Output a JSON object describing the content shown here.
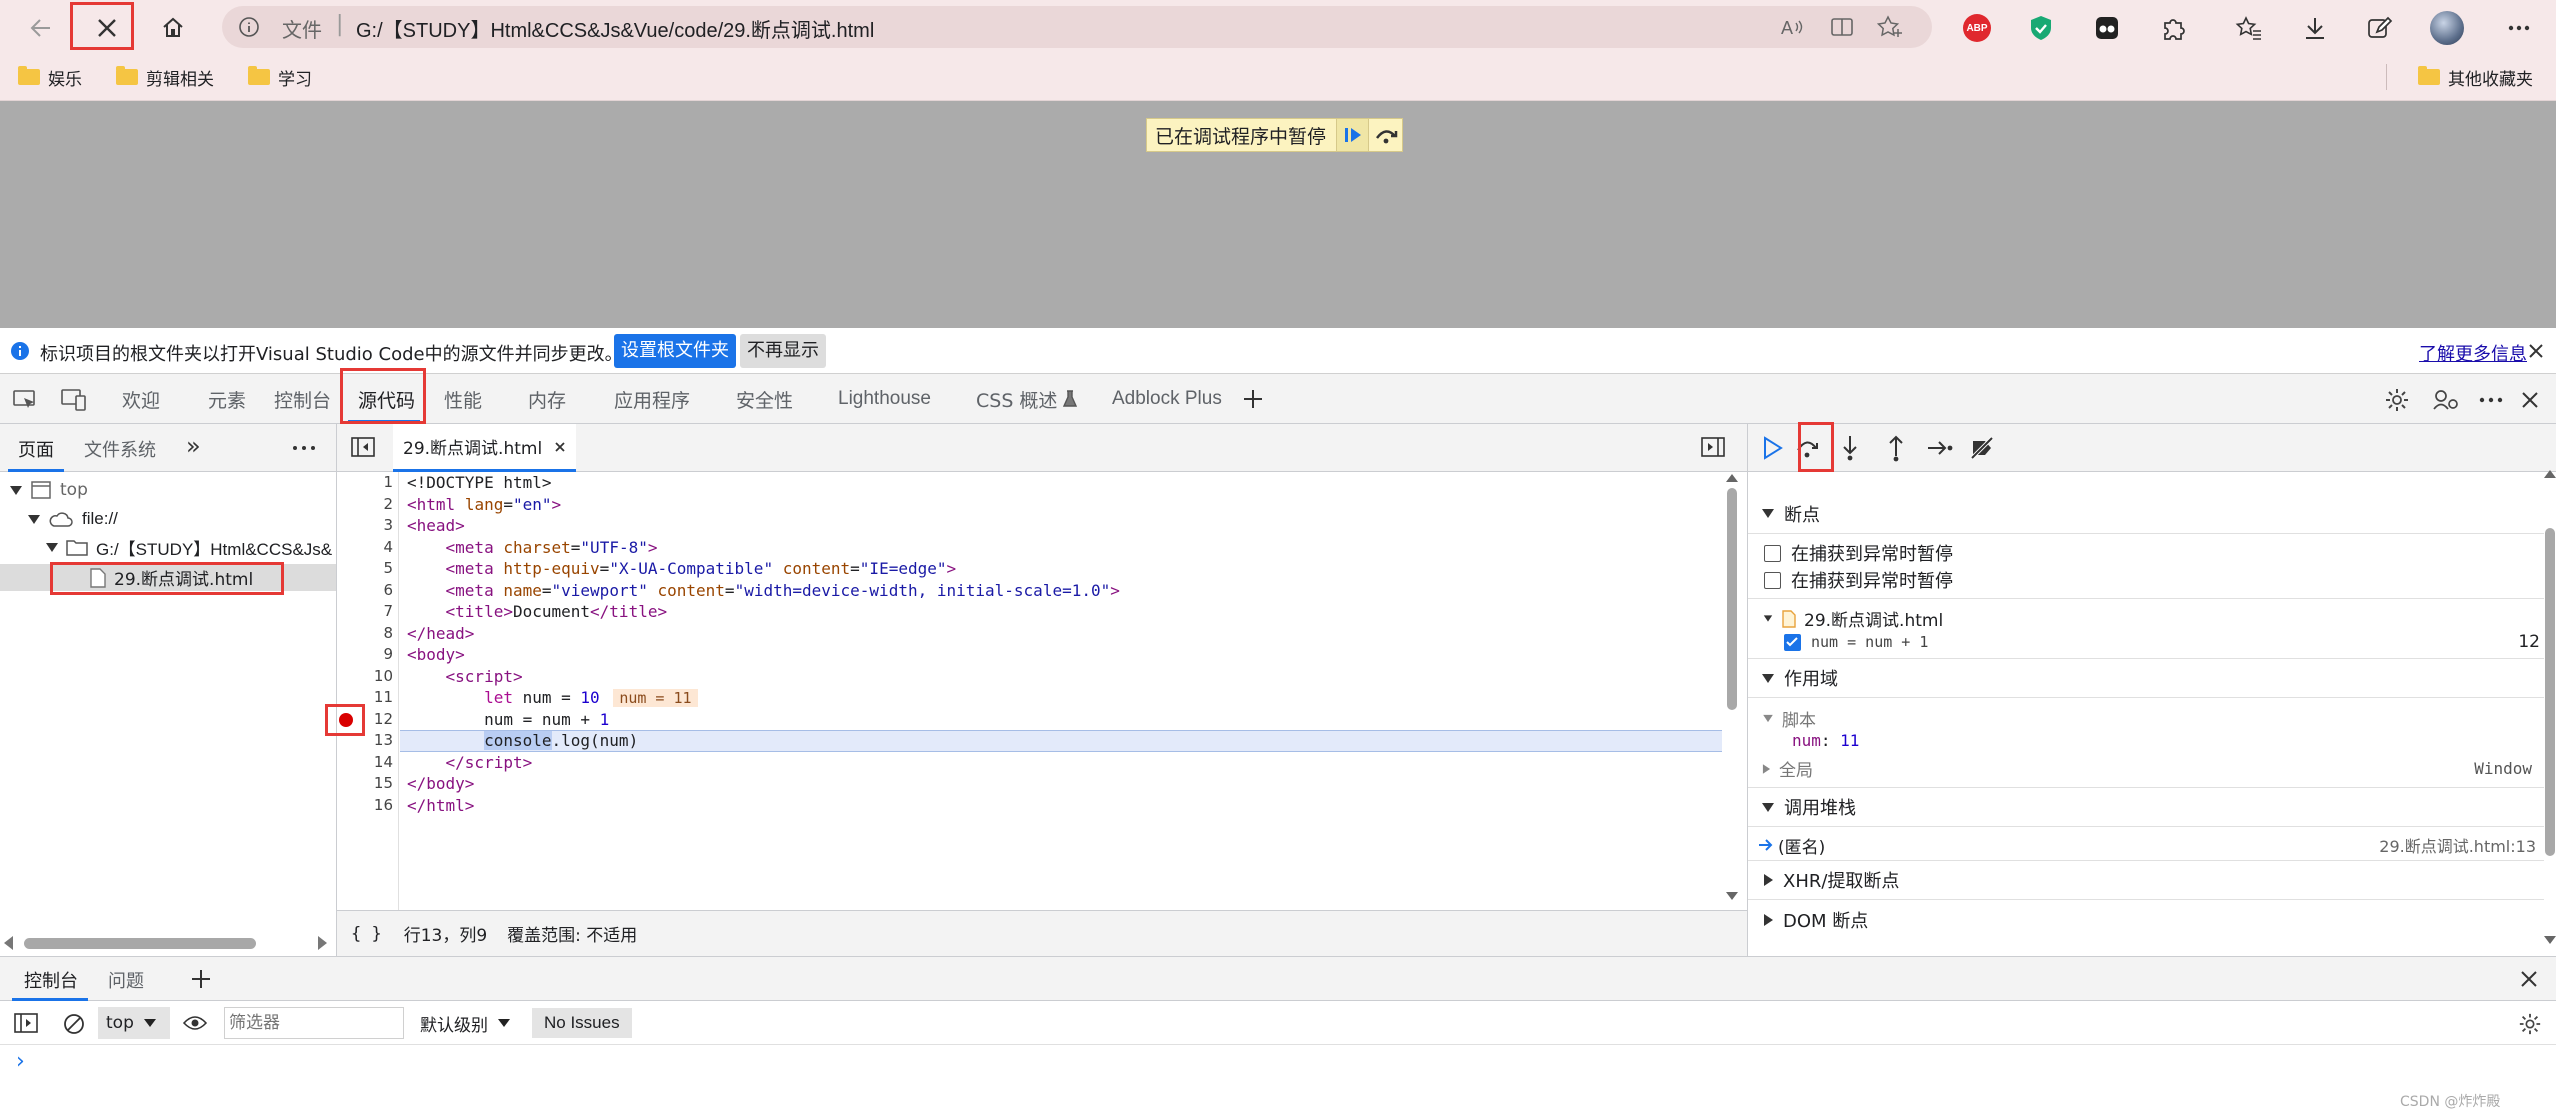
{
  "browser": {
    "address_prefix": "文件",
    "url": "G:/【STUDY】Html&CCS&Js&Vue/code/29.断点调试.html",
    "bookmarks": [
      "娱乐",
      "剪辑相关",
      "学习"
    ],
    "other_bookmarks": "其他收藏夹",
    "abp_label": "ABP"
  },
  "page": {
    "paused_text": "已在调试程序中暂停"
  },
  "infobar": {
    "message": "标识项目的根文件夹以打开Visual Studio Code中的源文件并同步更改。",
    "set_root_button": "设置根文件夹",
    "dont_show_button": "不再显示",
    "learn_more": "了解更多信息"
  },
  "devtools_tabs": [
    "欢迎",
    "元素",
    "控制台",
    "源代码",
    "性能",
    "内存",
    "应用程序",
    "安全性",
    "Lighthouse",
    "CSS 概述",
    "Adblock Plus"
  ],
  "navigator": {
    "tabs": [
      "页面",
      "文件系统"
    ],
    "tree": {
      "top": "top",
      "file_scheme": "file://",
      "folder": "G:/【STUDY】Html&CCS&Js&",
      "file": "29.断点调试.html"
    }
  },
  "editor": {
    "tab_label": "29.断点调试.html",
    "line_numbers": [
      "1",
      "2",
      "3",
      "4",
      "5",
      "6",
      "7",
      "8",
      "9",
      "10",
      "11",
      "12",
      "13",
      "14",
      "15",
      "16"
    ],
    "inline_value": "num = 11",
    "status_braces": "{ }",
    "status_position": "行13，列9",
    "status_coverage": "覆盖范围: 不适用"
  },
  "debugger": {
    "breakpoints_header": "断点",
    "pause_on_caught": "在捕获到异常时暂停",
    "pause_on_uncaught": "在捕获到异常时暂停",
    "bp_file": "29.断点调试.html",
    "bp_code": "num = num + 1",
    "bp_line": "12",
    "scope_header": "作用域",
    "scope_script": "脚本",
    "scope_var_name": "num",
    "scope_var_value": "11",
    "scope_global": "全局",
    "scope_global_value": "Window",
    "callstack_header": "调用堆栈",
    "frame_name": "(匿名)",
    "frame_location": "29.断点调试.html:13",
    "xhr_header": "XHR/提取断点",
    "dom_header": "DOM 断点"
  },
  "drawer": {
    "tabs": [
      "控制台",
      "问题"
    ],
    "context": "top",
    "filter_placeholder": "筛选器",
    "level": "默认级别",
    "issues": "No Issues",
    "prompt": "›"
  },
  "watermark": "CSDN @炸炸殿"
}
